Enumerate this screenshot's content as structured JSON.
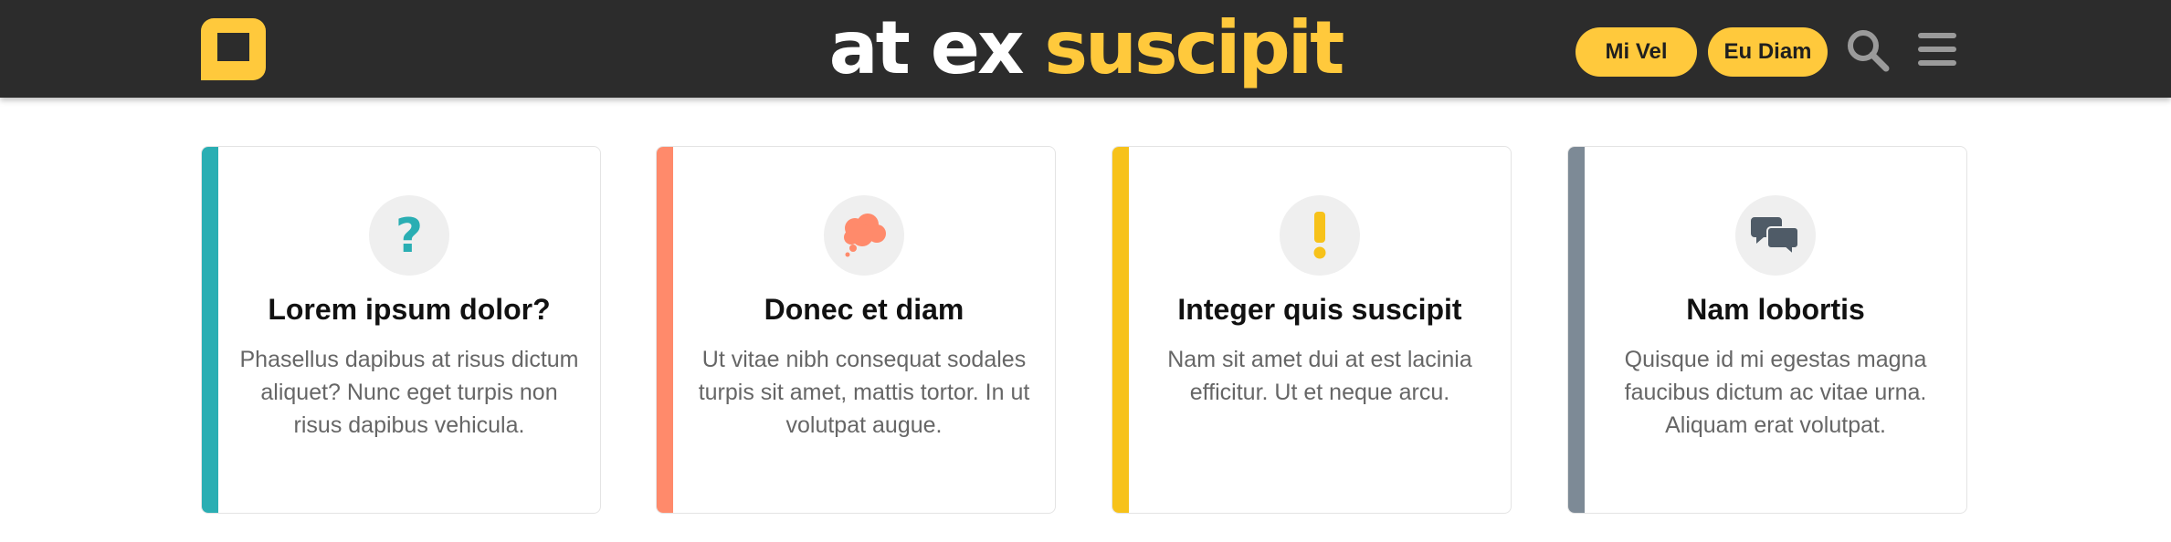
{
  "header": {
    "brand_part1": "at ex",
    "brand_part2": "suscipit",
    "button1_label": "Mi Vel",
    "button2_label": "Eu Diam",
    "logo_icon": "square-logo-icon",
    "search_icon": "search-icon",
    "menu_icon": "hamburger-menu-icon"
  },
  "colors": {
    "header_bg": "#2c2c2c",
    "brand_yellow": "#ffc93c",
    "teal": "#2aaeb3",
    "coral": "#ff8a6b",
    "yellow": "#f7c21a",
    "slate": "#7d8a96"
  },
  "cards": [
    {
      "title": "Lorem ipsum dolor?",
      "description": "Phasellus dapibus at risus dictum aliquet? Nunc eget turpis non risus dapibus vehicula.",
      "icon": "question-mark-icon",
      "accent": "#2aaeb3"
    },
    {
      "title": "Donec et diam",
      "description": "Ut vitae nibh consequat sodales turpis sit amet, mattis tortor. In ut volutpat augue.",
      "icon": "thought-cloud-icon",
      "accent": "#ff8a6b"
    },
    {
      "title": "Integer quis suscipit",
      "description": "Nam sit amet dui at est lacinia efficitur. Ut et neque arcu.",
      "icon": "exclamation-icon",
      "accent": "#f7c21a"
    },
    {
      "title": "Nam lobortis",
      "description": "Quisque id mi egestas magna faucibus dictum ac vitae urna. Aliquam erat volutpat.",
      "icon": "chat-bubbles-icon",
      "accent": "#7d8a96"
    }
  ]
}
